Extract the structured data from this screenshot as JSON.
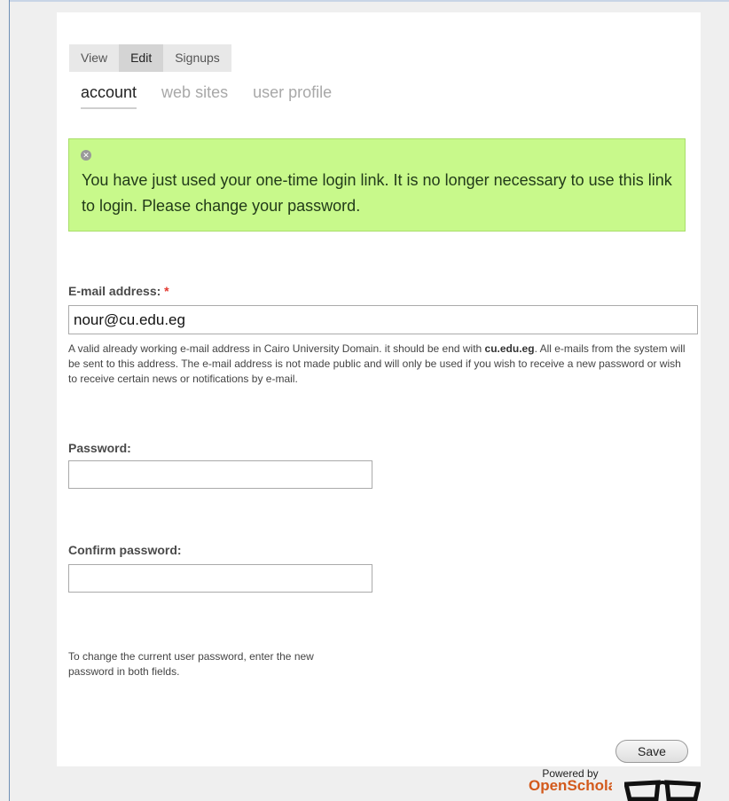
{
  "tabs": [
    {
      "label": "View",
      "active": false
    },
    {
      "label": "Edit",
      "active": true
    },
    {
      "label": "Signups",
      "active": false
    }
  ],
  "subtabs": [
    {
      "label": "account",
      "active": true
    },
    {
      "label": "web sites",
      "active": false
    },
    {
      "label": "user profile",
      "active": false
    }
  ],
  "message": {
    "close_icon": "x-circle-icon",
    "text": "You have just used your one-time login link. It is no longer necessary to use this link to login. Please change your password."
  },
  "email": {
    "label": "E-mail address:",
    "required_marker": "*",
    "value": "nour@cu.edu.eg",
    "help_before": "A valid already working e-mail address in Cairo University Domain. it should be end with ",
    "help_domain": "cu.edu.eg",
    "help_after": ". All e-mails from the system will be sent to this address. The e-mail address is not made public and will only be used if you wish to receive a new password or wish to receive certain news or notifications by e-mail."
  },
  "password": {
    "label": "Password:",
    "value": ""
  },
  "confirm_password": {
    "label": "Confirm password:",
    "value": ""
  },
  "password_help": "To change the current user password, enter the new password in both fields.",
  "save_label": "Save",
  "footer": {
    "powered_by": "Powered by",
    "brand": "OpenScholar",
    "logo_icon": "glasses-icon"
  }
}
